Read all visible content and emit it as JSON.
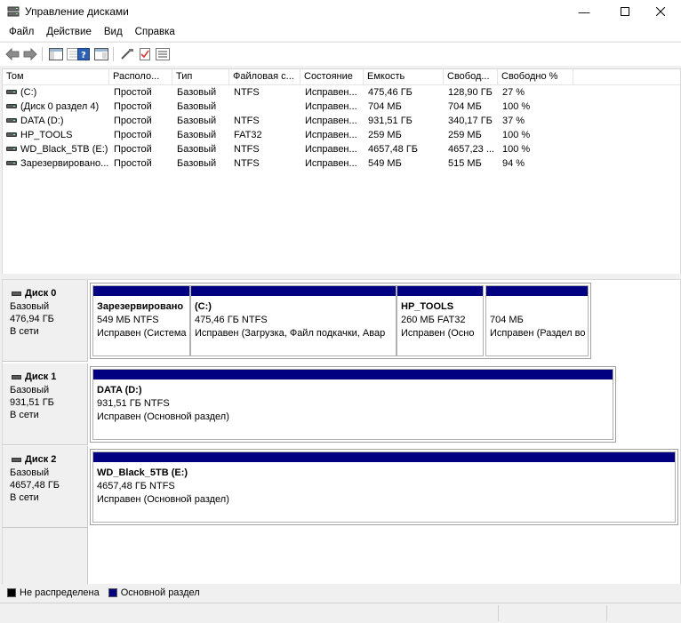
{
  "window": {
    "title": "Управление дисками"
  },
  "menu": [
    "Файл",
    "Действие",
    "Вид",
    "Справка"
  ],
  "columns": [
    "Том",
    "Располо...",
    "Тип",
    "Файловая с...",
    "Состояние",
    "Емкость",
    "Свобод...",
    "Свободно %"
  ],
  "volumes": [
    {
      "name": "(C:)",
      "layout": "Простой",
      "type": "Базовый",
      "fs": "NTFS",
      "status": "Исправен...",
      "capacity": "475,46 ГБ",
      "free": "128,90 ГБ",
      "free_pct": "27 %"
    },
    {
      "name": "(Диск 0 раздел 4)",
      "layout": "Простой",
      "type": "Базовый",
      "fs": "",
      "status": "Исправен...",
      "capacity": "704 МБ",
      "free": "704 МБ",
      "free_pct": "100 %"
    },
    {
      "name": "DATA (D:)",
      "layout": "Простой",
      "type": "Базовый",
      "fs": "NTFS",
      "status": "Исправен...",
      "capacity": "931,51 ГБ",
      "free": "340,17 ГБ",
      "free_pct": "37 %"
    },
    {
      "name": "HP_TOOLS",
      "layout": "Простой",
      "type": "Базовый",
      "fs": "FAT32",
      "status": "Исправен...",
      "capacity": "259 МБ",
      "free": "259 МБ",
      "free_pct": "100 %"
    },
    {
      "name": "WD_Black_5TB (E:)",
      "layout": "Простой",
      "type": "Базовый",
      "fs": "NTFS",
      "status": "Исправен...",
      "capacity": "4657,48 ГБ",
      "free": "4657,23 ...",
      "free_pct": "100 %"
    },
    {
      "name": "Зарезервировано...",
      "layout": "Простой",
      "type": "Базовый",
      "fs": "NTFS",
      "status": "Исправен...",
      "capacity": "549 МБ",
      "free": "515 МБ",
      "free_pct": "94 %"
    }
  ],
  "disks": [
    {
      "name": "Диск 0",
      "type": "Базовый",
      "size": "476,94 ГБ",
      "state": "В сети",
      "partitions": [
        {
          "name": "Зарезервировано",
          "size": "549 МБ NTFS",
          "status": "Исправен (Система"
        },
        {
          "name": "(C:)",
          "size": "475,46 ГБ NTFS",
          "status": "Исправен (Загрузка, Файл подкачки, Авар"
        },
        {
          "name": "HP_TOOLS",
          "size": "260 МБ FAT32",
          "status": "Исправен (Осно"
        },
        {
          "name": "",
          "size": "704 МБ",
          "status": "Исправен (Раздел во"
        }
      ]
    },
    {
      "name": "Диск 1",
      "type": "Базовый",
      "size": "931,51 ГБ",
      "state": "В сети",
      "partitions": [
        {
          "name": "DATA  (D:)",
          "size": "931,51 ГБ NTFS",
          "status": "Исправен (Основной раздел)"
        }
      ]
    },
    {
      "name": "Диск 2",
      "type": "Базовый",
      "size": "4657,48 ГБ",
      "state": "В сети",
      "partitions": [
        {
          "name": "WD_Black_5TB  (E:)",
          "size": "4657,48 ГБ NTFS",
          "status": "Исправен (Основной раздел)"
        }
      ]
    }
  ],
  "legend": [
    {
      "label": "Не распределена",
      "color": "#000000"
    },
    {
      "label": "Основной раздел",
      "color": "#000080"
    }
  ]
}
